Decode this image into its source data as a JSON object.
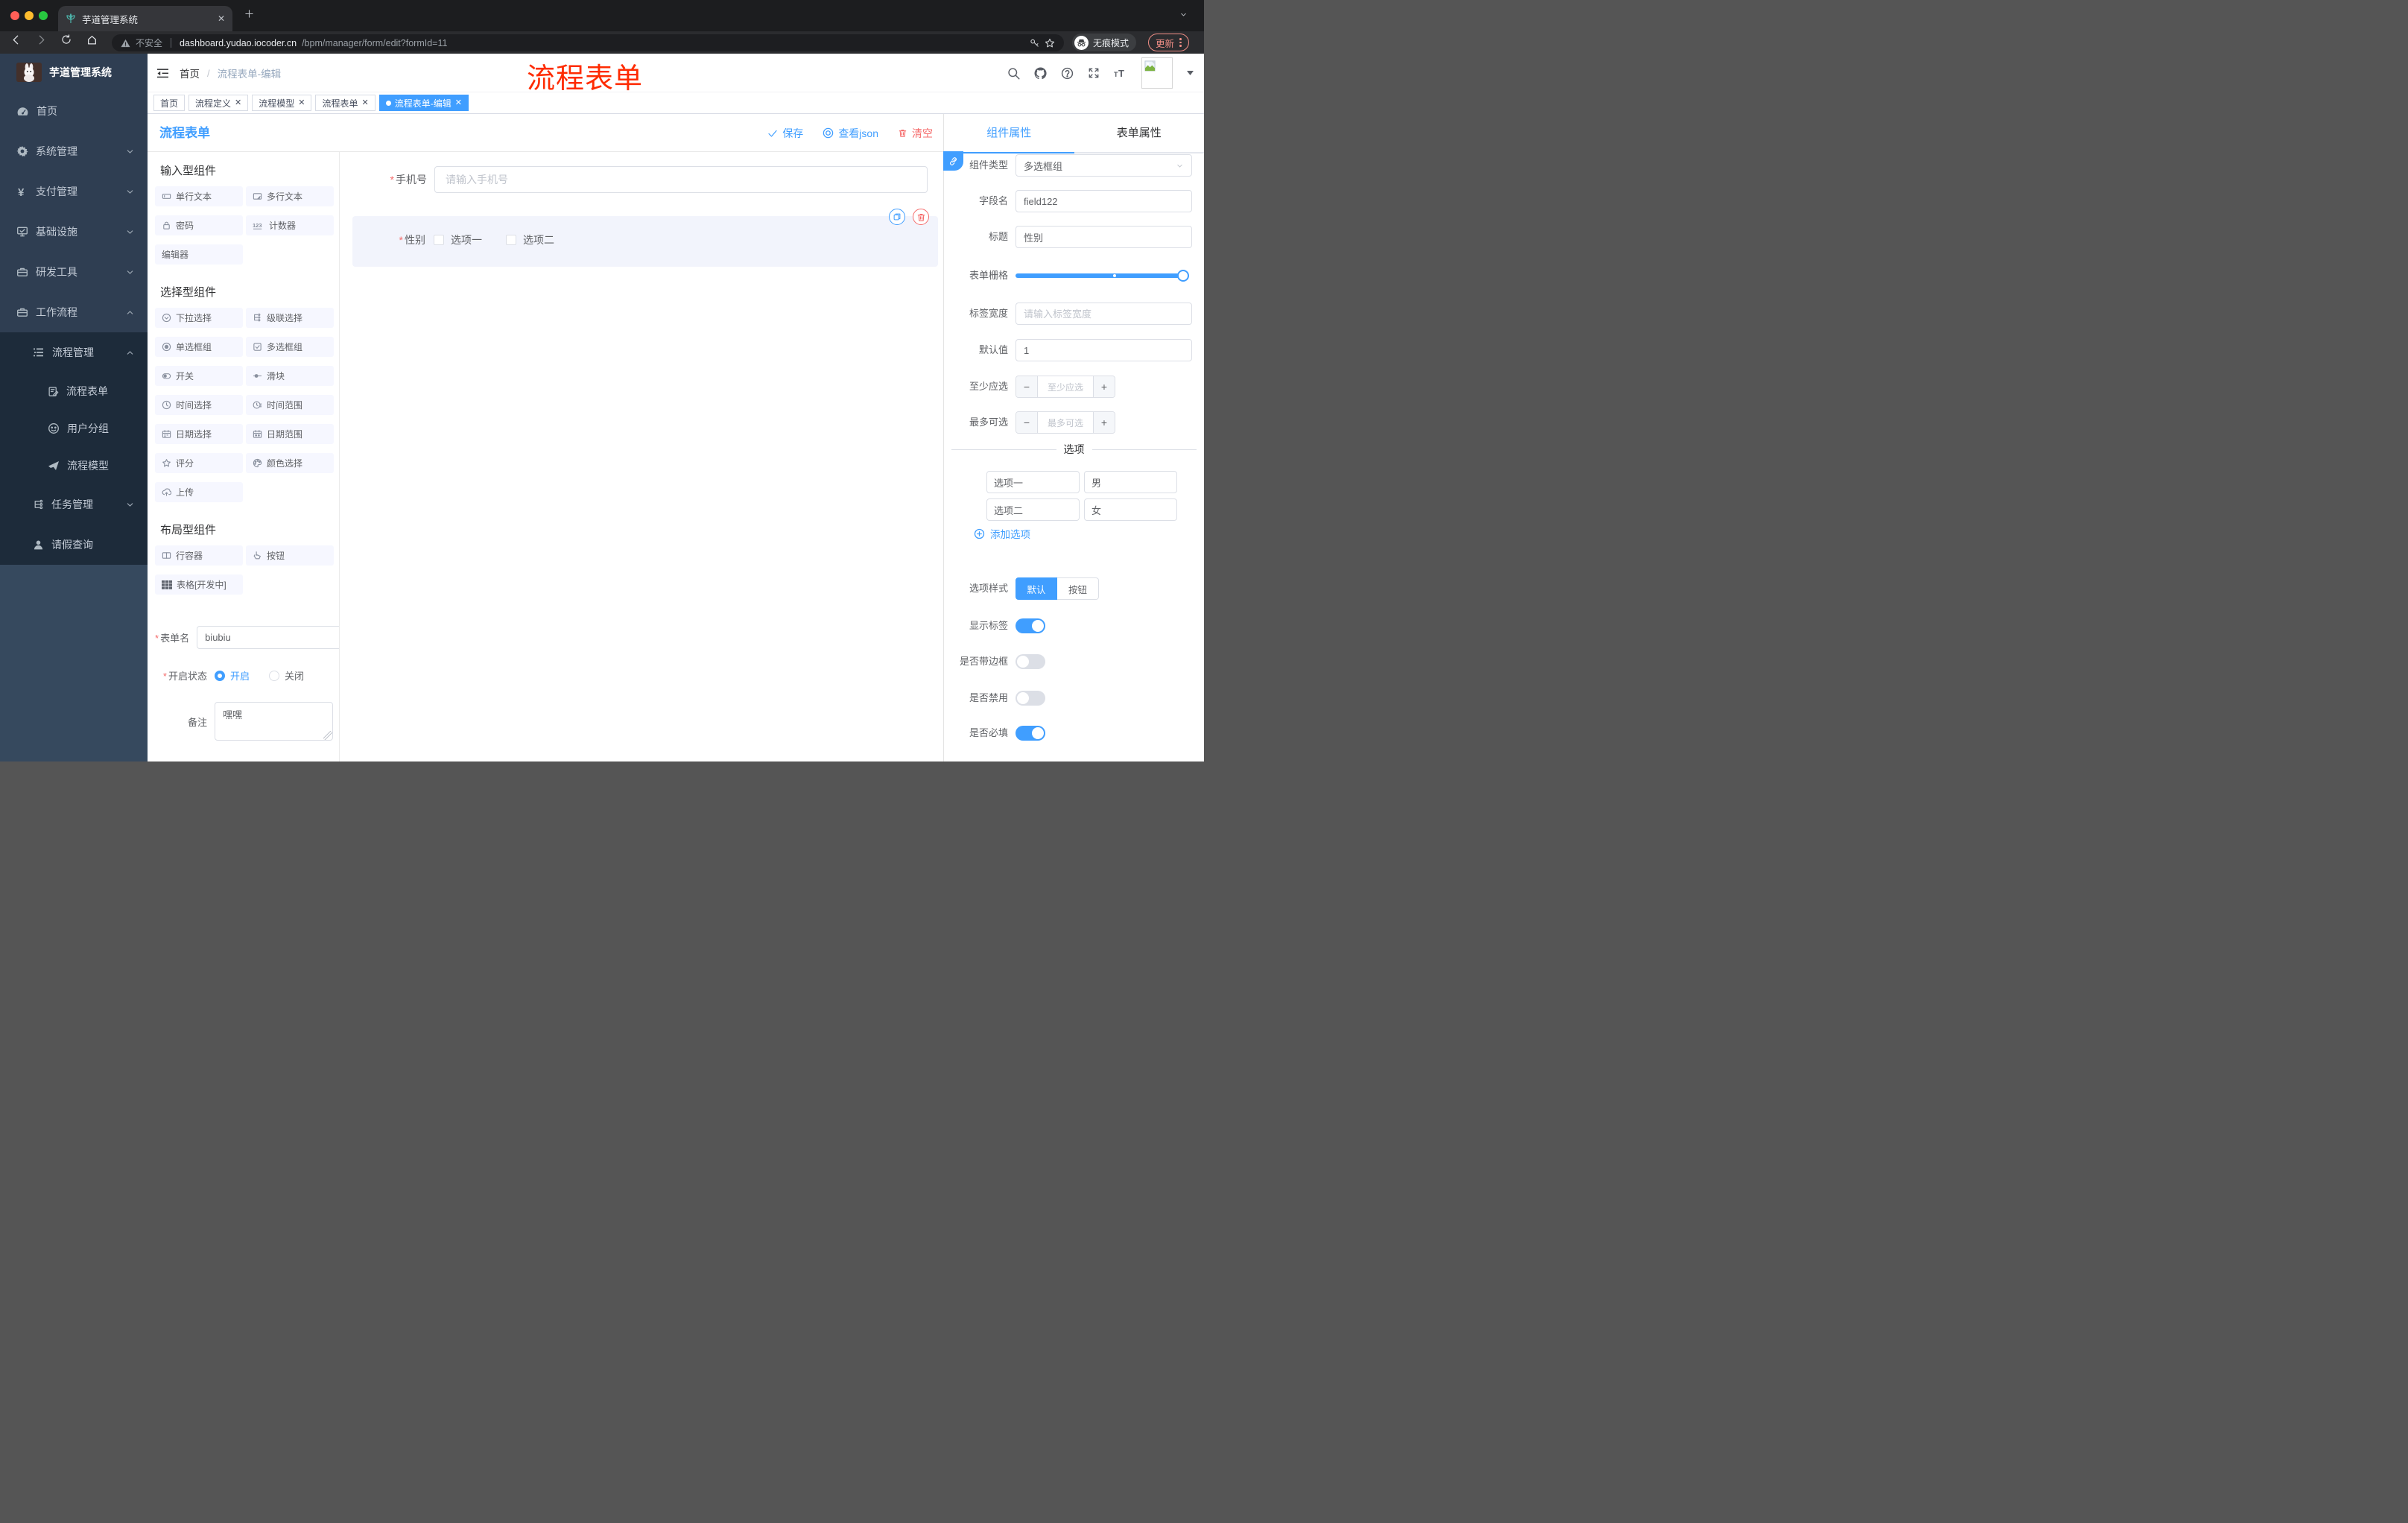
{
  "colors": {
    "accent": "#409EFF",
    "danger": "#F56C6C",
    "annotation": "#FE2B01",
    "active_tag": "#409EFF"
  },
  "browser": {
    "tab_title": "芋道管理系统",
    "security_label": "不安全",
    "url_host": "dashboard.yudao.iocoder.cn",
    "url_path": "/bpm/manager/form/edit?formId=11",
    "incognito_label": "无痕模式",
    "update_label": "更新"
  },
  "sidebar": {
    "logo_title": "芋道管理系统",
    "menu": [
      {
        "label": "首页",
        "icon": "dashboard",
        "level": 1,
        "chevron": "",
        "dark": false
      },
      {
        "label": "系统管理",
        "icon": "gear",
        "level": 1,
        "chevron": "down",
        "dark": false
      },
      {
        "label": "支付管理",
        "icon": "yen",
        "level": 1,
        "chevron": "down",
        "dark": false
      },
      {
        "label": "基础设施",
        "icon": "monitor",
        "level": 1,
        "chevron": "down",
        "dark": false
      },
      {
        "label": "研发工具",
        "icon": "briefcase",
        "level": 1,
        "chevron": "down",
        "dark": false
      },
      {
        "label": "工作流程",
        "icon": "briefcase",
        "level": 1,
        "chevron": "up",
        "dark": false
      },
      {
        "label": "流程管理",
        "icon": "listmenu",
        "level": 2,
        "chevron": "up",
        "dark": true
      },
      {
        "label": "流程表单",
        "icon": "doc-edit",
        "level": 3,
        "chevron": "",
        "dark": true
      },
      {
        "label": "用户分组",
        "icon": "face",
        "level": 3,
        "chevron": "",
        "dark": true
      },
      {
        "label": "流程模型",
        "icon": "send",
        "level": 3,
        "chevron": "",
        "dark": true
      },
      {
        "label": "任务管理",
        "icon": "tree",
        "level": 2,
        "chevron": "down",
        "dark": true
      },
      {
        "label": "请假查询",
        "icon": "user",
        "level": 2,
        "chevron": "",
        "dark": true
      }
    ]
  },
  "header": {
    "breadcrumb_home": "首页",
    "breadcrumb_sep": "/",
    "breadcrumb_current": "流程表单-编辑",
    "annotation": "流程表单"
  },
  "tags": [
    {
      "label": "首页",
      "closable": false,
      "active": false
    },
    {
      "label": "流程定义",
      "closable": true,
      "active": false
    },
    {
      "label": "流程模型",
      "closable": true,
      "active": false
    },
    {
      "label": "流程表单",
      "closable": true,
      "active": false
    },
    {
      "label": "流程表单-编辑",
      "closable": true,
      "active": true
    }
  ],
  "designer": {
    "title": "流程表单",
    "actions": {
      "save": "保存",
      "view_json": "查看json",
      "clear": "清空"
    },
    "sections": [
      {
        "title": "输入型组件",
        "items": [
          {
            "label": "单行文本",
            "icon": "input"
          },
          {
            "label": "多行文本",
            "icon": "textarea"
          },
          {
            "label": "密码",
            "icon": "lock"
          },
          {
            "label": "计数器",
            "icon": "counter"
          },
          {
            "label": "编辑器",
            "icon": "none"
          }
        ]
      },
      {
        "title": "选择型组件",
        "items": [
          {
            "label": "下拉选择",
            "icon": "select"
          },
          {
            "label": "级联选择",
            "icon": "cascader"
          },
          {
            "label": "单选框组",
            "icon": "radio"
          },
          {
            "label": "多选框组",
            "icon": "checkbox"
          },
          {
            "label": "开关",
            "icon": "switch"
          },
          {
            "label": "滑块",
            "icon": "slider"
          },
          {
            "label": "时间选择",
            "icon": "time"
          },
          {
            "label": "时间范围",
            "icon": "time-range"
          },
          {
            "label": "日期选择",
            "icon": "date"
          },
          {
            "label": "日期范围",
            "icon": "date-range"
          },
          {
            "label": "评分",
            "icon": "star"
          },
          {
            "label": "颜色选择",
            "icon": "palette"
          },
          {
            "label": "上传",
            "icon": "upload"
          }
        ]
      },
      {
        "title": "布局型组件",
        "items": [
          {
            "label": "行容器",
            "icon": "columns"
          },
          {
            "label": "按钮",
            "icon": "pointer"
          },
          {
            "label": "表格[开发中]",
            "icon": "table"
          }
        ]
      }
    ],
    "form": {
      "name_label": "表单名",
      "name_value": "biubiu",
      "status_label": "开启状态",
      "status_on": "开启",
      "status_off": "关闭",
      "status_selected": "开启",
      "remark_label": "备注",
      "remark_value": "嘿嘿"
    },
    "canvas": {
      "phone": {
        "label": "手机号",
        "placeholder": "请输入手机号",
        "required": true
      },
      "gender": {
        "label": "性别",
        "required": true,
        "options": [
          "选项一",
          "选项二"
        ]
      }
    }
  },
  "inspector": {
    "tab_component": "组件属性",
    "tab_form": "表单属性",
    "active_tab": "组件属性",
    "fields": {
      "type_label": "组件类型",
      "type_value": "多选框组",
      "name_label": "字段名",
      "name_value": "field122",
      "title_label": "标题",
      "title_value": "性别",
      "grid_label": "表单栅格",
      "width_label": "标签宽度",
      "width_placeholder": "请输入标签宽度",
      "default_label": "默认值",
      "default_value": "1",
      "min_label": "至少应选",
      "min_placeholder": "至少应选",
      "max_label": "最多可选",
      "max_placeholder": "最多可选"
    },
    "options": {
      "divider": "选项",
      "rows": [
        {
          "label": "选项一",
          "value": "男"
        },
        {
          "label": "选项二",
          "value": "女"
        }
      ],
      "add_label": "添加选项"
    },
    "style": {
      "label": "选项样式",
      "options": [
        "默认",
        "按钮"
      ],
      "selected": "默认"
    },
    "toggles": [
      {
        "label": "显示标签",
        "on": true
      },
      {
        "label": "是否带边框",
        "on": false
      },
      {
        "label": "是否禁用",
        "on": false
      },
      {
        "label": "是否必填",
        "on": true
      }
    ]
  }
}
